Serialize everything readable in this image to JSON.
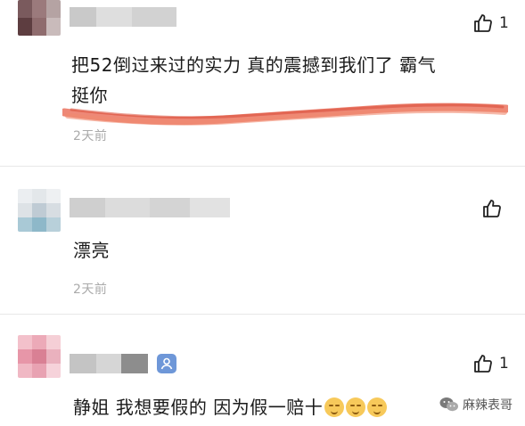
{
  "comments": [
    {
      "text": "把52倒过来过的实力 真的震撼到我们了 霸气 挺你",
      "time": "2天前",
      "like_count": "1"
    },
    {
      "text": "漂亮",
      "time": "2天前",
      "like_count": ""
    },
    {
      "text": "静姐 我想要假的 因为假一赔十",
      "time": "",
      "like_count": "1"
    }
  ],
  "watermark": {
    "label": "麻辣表哥"
  },
  "icons": {
    "like": "thumbs-up-icon",
    "verified": "verified-badge-icon",
    "emoji": "smirk-emoji-icon",
    "watermark": "wechat-icon"
  },
  "colors": {
    "time_text": "#aaaaaa",
    "scribble": "#e8604a",
    "badge": "#6e97d8",
    "emoji": "#f7c95a"
  }
}
